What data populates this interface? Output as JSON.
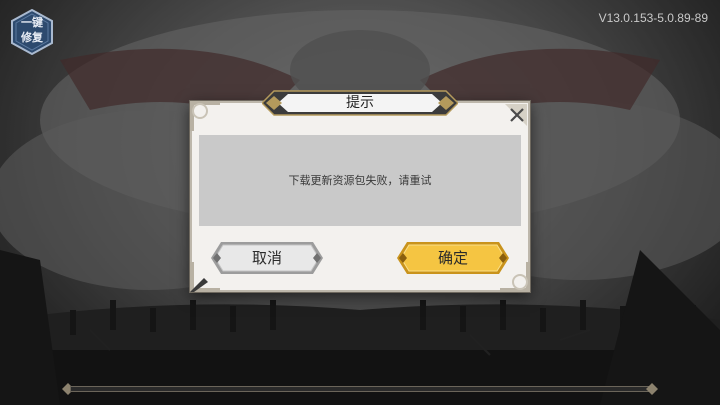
{
  "repair_button": {
    "line1": "一键",
    "line2": "修复",
    "icon": "hexagon-badge-icon"
  },
  "version": "V13.0.153-5.0.89-89",
  "dialog": {
    "title": "提示",
    "message": "下载更新资源包失败，请重试",
    "close_icon": "close-x-icon",
    "cancel_label": "取消",
    "confirm_label": "确定"
  },
  "colors": {
    "confirm_button": "#f5c542",
    "cancel_button": "#e6e6e6",
    "message_bg": "#c9c9c9",
    "dialog_bg": "#f3f1ee"
  }
}
